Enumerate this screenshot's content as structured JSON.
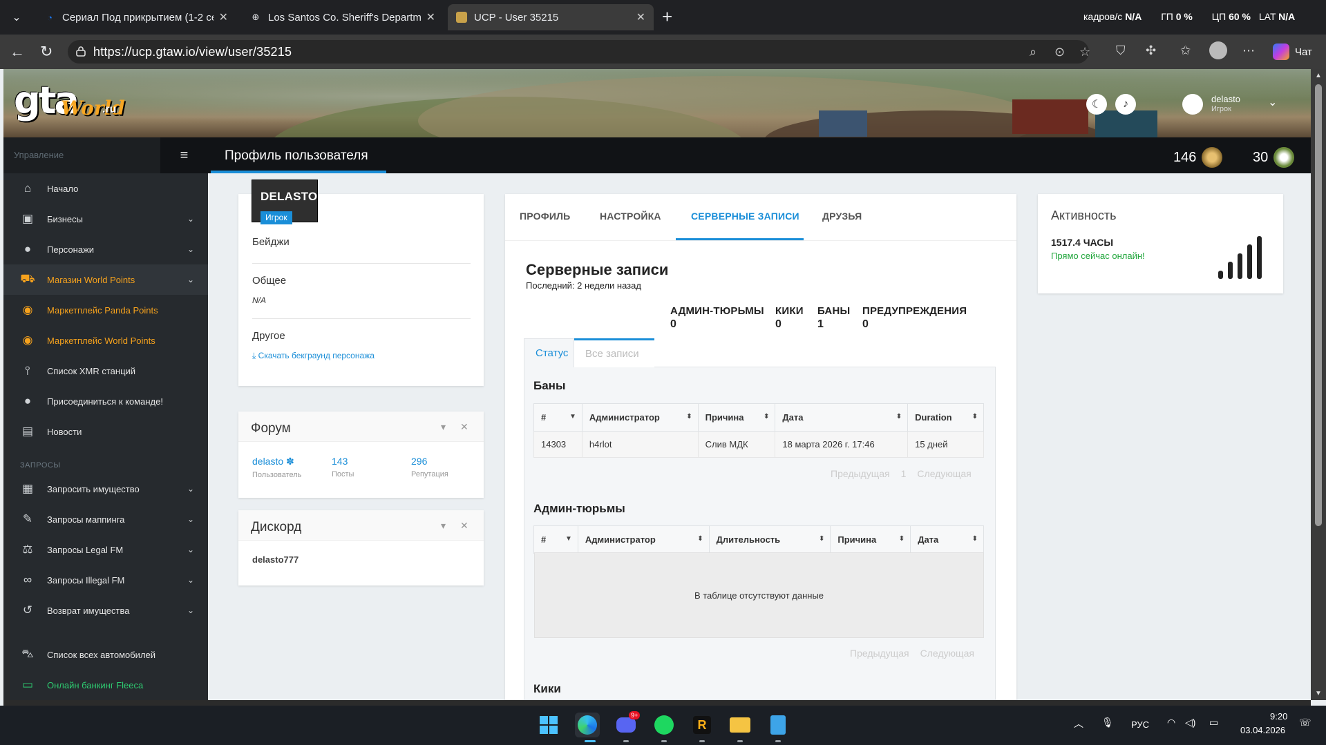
{
  "browser": {
    "tabs": [
      {
        "label": "Сериал Под прикрытием (1-2 сезон)"
      },
      {
        "label": "Los Santos Co. Sheriff's Department"
      },
      {
        "label": "UCP - User 35215"
      }
    ],
    "stats": {
      "fps_label": "кадров/с",
      "fps_value": "N/A",
      "gpu_label": "ГП",
      "gpu_value": "0 %",
      "cpu_label": "ЦП",
      "cpu_value": "60 %",
      "lat_label": "LAT",
      "lat_value": "N/A"
    },
    "url": "https://ucp.gtaw.io/view/user/35215",
    "chat_label": "Чат"
  },
  "site": {
    "logo": {
      "g": "gta",
      "w": "World",
      "ru": ".ru"
    },
    "user": {
      "name": "delasto",
      "role": "Игрок"
    }
  },
  "sidebar": {
    "management_label": "Управление",
    "items": [
      {
        "label": "Начало",
        "icon": "home-icon"
      },
      {
        "label": "Бизнесы",
        "icon": "briefcase-icon"
      },
      {
        "label": "Персонажи",
        "icon": "user-icon"
      },
      {
        "label": "Магазин World Points",
        "icon": "cart-icon"
      },
      {
        "label": "Маркетплейс Panda Points",
        "icon": "coins-icon"
      },
      {
        "label": "Маркетплейс World Points",
        "icon": "coins-icon"
      },
      {
        "label": "Список XMR станций",
        "icon": "antenna-icon"
      },
      {
        "label": "Присоединиться к команде!",
        "icon": "user-plus-icon"
      },
      {
        "label": "Новости",
        "icon": "newspaper-icon"
      }
    ],
    "requests_label": "ЗАПРОСЫ",
    "requests": [
      {
        "label": "Запросить имущество",
        "icon": "building-icon"
      },
      {
        "label": "Запросы маппинга",
        "icon": "brush-icon"
      },
      {
        "label": "Запросы Legal FM",
        "icon": "scales-icon"
      },
      {
        "label": "Запросы Illegal FM",
        "icon": "mask-icon"
      },
      {
        "label": "Возврат имущества",
        "icon": "undo-icon"
      }
    ],
    "extra": [
      {
        "label": "Список всех автомобилей",
        "icon": "car-icon"
      },
      {
        "label": "Онлайн банкинг Fleeca",
        "icon": "money-icon"
      }
    ]
  },
  "page": {
    "title": "Профиль пользователя",
    "stat1": "146",
    "stat2": "30"
  },
  "profile": {
    "name": "DELASTO",
    "role": "Игрок",
    "badges_label": "Бейджи",
    "general_label": "Общее",
    "general_value": "N/A",
    "other_label": "Другое",
    "download_label": "Скачать бекграунд персонажа"
  },
  "forum": {
    "title": "Форум",
    "user": "delasto",
    "user_label": "Пользователь",
    "posts": "143",
    "posts_label": "Посты",
    "rep": "296",
    "rep_label": "Репутация"
  },
  "discord": {
    "title": "Дискорд",
    "name": "delasto777"
  },
  "tabs": [
    "ПРОФИЛЬ",
    "НАСТРОЙКА",
    "СЕРВЕРНЫЕ ЗАПИСИ",
    "ДРУЗЬЯ"
  ],
  "records": {
    "title": "Серверные записи",
    "last": "Последний: 2 недели назад",
    "counts": [
      {
        "label": "АДМИН-ТЮРЬМЫ",
        "value": "0"
      },
      {
        "label": "КИКИ",
        "value": "0"
      },
      {
        "label": "БАНЫ",
        "value": "1"
      },
      {
        "label": "ПРЕДУПРЕЖДЕНИЯ",
        "value": "0"
      }
    ],
    "subtabs": [
      "Статус",
      "Все записи"
    ],
    "bans": {
      "title": "Баны",
      "columns": [
        "#",
        "Администратор",
        "Причина",
        "Дата",
        "Duration"
      ],
      "rows": [
        [
          "14303",
          "h4rlot",
          "Слив МДК",
          "18 марта 2026 г. 17:46",
          "15 дней"
        ]
      ],
      "prev": "Предыдущая",
      "page": "1",
      "next": "Следующая"
    },
    "jails": {
      "title": "Админ-тюрьмы",
      "columns": [
        "#",
        "Администратор",
        "Длительность",
        "Причина",
        "Дата"
      ],
      "empty": "В таблице отсутствуют данные",
      "prev": "Предыдущая",
      "next": "Следующая"
    },
    "kicks_title": "Кики"
  },
  "activity": {
    "title": "Активность",
    "hours": "1517.4 ЧАСЫ",
    "status": "Прямо сейчас онлайн!",
    "bars": [
      0.2,
      0.4,
      0.6,
      0.8,
      1.0
    ]
  },
  "taskbar": {
    "lang": "РУС",
    "time": "9:20",
    "date": "03.04.2026",
    "discord_badge": "9+"
  }
}
